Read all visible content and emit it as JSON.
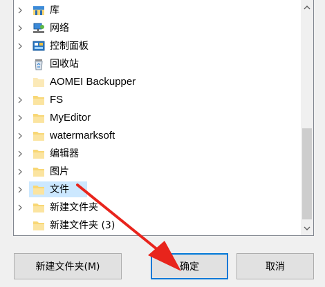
{
  "tree": {
    "items": [
      {
        "label": "库",
        "icon": "library-icon",
        "has_chevron": true
      },
      {
        "label": "网络",
        "icon": "network-icon",
        "has_chevron": true
      },
      {
        "label": "控制面板",
        "icon": "control-panel-icon",
        "has_chevron": true
      },
      {
        "label": "回收站",
        "icon": "recycle-bin-icon",
        "has_chevron": false
      },
      {
        "label": "AOMEI Backupper",
        "icon": "folder-icon",
        "has_chevron": false
      },
      {
        "label": "FS",
        "icon": "folder-icon",
        "has_chevron": true
      },
      {
        "label": "MyEditor",
        "icon": "folder-icon",
        "has_chevron": true
      },
      {
        "label": "watermarksoft",
        "icon": "folder-icon",
        "has_chevron": true
      },
      {
        "label": "编辑器",
        "icon": "folder-icon",
        "has_chevron": true
      },
      {
        "label": "图片",
        "icon": "folder-icon",
        "has_chevron": true
      },
      {
        "label": "文件",
        "icon": "folder-icon",
        "has_chevron": true,
        "selected": true
      },
      {
        "label": "新建文件夹",
        "icon": "folder-icon",
        "has_chevron": true
      },
      {
        "label": "新建文件夹 (3)",
        "icon": "folder-icon",
        "has_chevron": false
      }
    ]
  },
  "buttons": {
    "new_folder": "新建文件夹(M)",
    "ok": "确定",
    "cancel": "取消"
  },
  "colors": {
    "selection": "#cce8ff",
    "folder": "#f8d775",
    "annotation_arrow": "#e8241c",
    "default_button_border": "#0078d7"
  }
}
